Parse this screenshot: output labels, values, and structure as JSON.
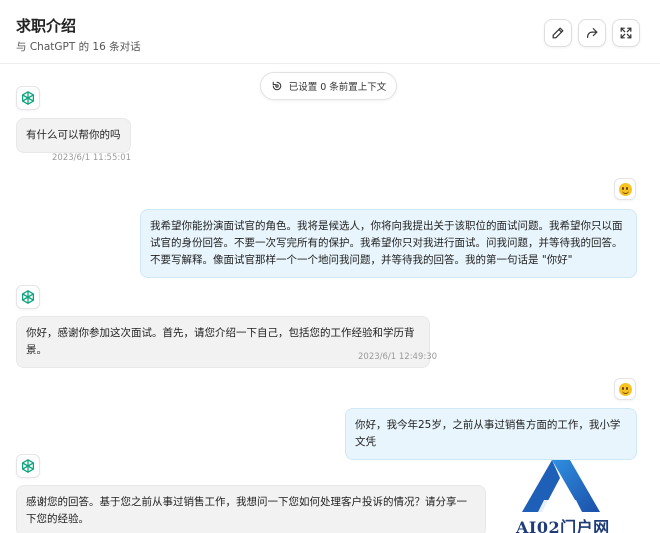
{
  "header": {
    "title": "求职介绍",
    "subtitle": "与 ChatGPT 的 16 条对话",
    "buttons": {
      "edit": "edit-icon",
      "share": "share-icon",
      "fullscreen": "fullscreen-icon"
    }
  },
  "context": {
    "label": "已设置 0 条前置上下文"
  },
  "messages": [
    {
      "role": "bot",
      "text": "有什么可以帮你的吗",
      "time": "2023/6/1 11:55:01"
    },
    {
      "role": "user",
      "text": "我希望你能扮演面试官的角色。我将是候选人，你将向我提出关于该职位的面试问题。我希望你只以面试官的身份回答。不要一次写完所有的保护。我希望你只对我进行面试。问我问题，并等待我的回答。不要写解释。像面试官那样一个一个地问我问题，并等待我的回答。我的第一句话是 \"你好\""
    },
    {
      "role": "bot",
      "text": "你好，感谢你参加这次面试。首先，请您介绍一下自己，包括您的工作经验和学历背景。",
      "time": "2023/6/1 12:49:30"
    },
    {
      "role": "user",
      "text": "你好，我今年25岁，之前从事过销售方面的工作，我小学文凭"
    },
    {
      "role": "bot",
      "text": "感谢您的回答。基于您之前从事过销售工作，我想问一下您如何处理客户投诉的情况？请分享一下您的经验。"
    }
  ],
  "watermark": {
    "text": "AI02门户网"
  },
  "colors": {
    "user_bubble": "#e8f5fc",
    "bot_bubble": "#f2f2f2",
    "accent": "#10a37f",
    "watermark": "#1d3c78"
  }
}
